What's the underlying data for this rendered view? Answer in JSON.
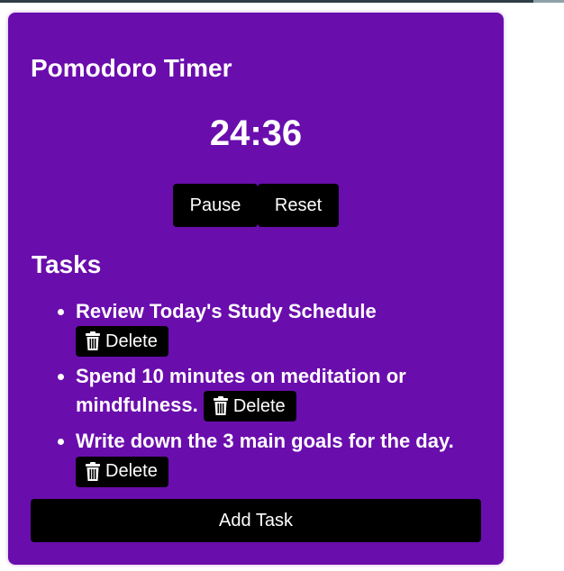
{
  "title": "Pomodoro Timer",
  "timer": {
    "display": "24:36"
  },
  "controls": {
    "pause_label": "Pause",
    "reset_label": "Reset"
  },
  "tasks": {
    "heading": "Tasks",
    "items": [
      {
        "text": "Review Today's Study Schedule",
        "delete_label": "Delete"
      },
      {
        "text": "Spend 10 minutes on meditation or mindfulness.",
        "delete_label": "Delete"
      },
      {
        "text": "Write down the 3 main goals for the day.",
        "delete_label": "Delete"
      }
    ],
    "add_label": "Add Task"
  },
  "icons": {
    "delete": "trash-icon"
  },
  "colors": {
    "card_bg": "#6a0dad",
    "button_bg": "#000000",
    "text": "#ffffff"
  }
}
